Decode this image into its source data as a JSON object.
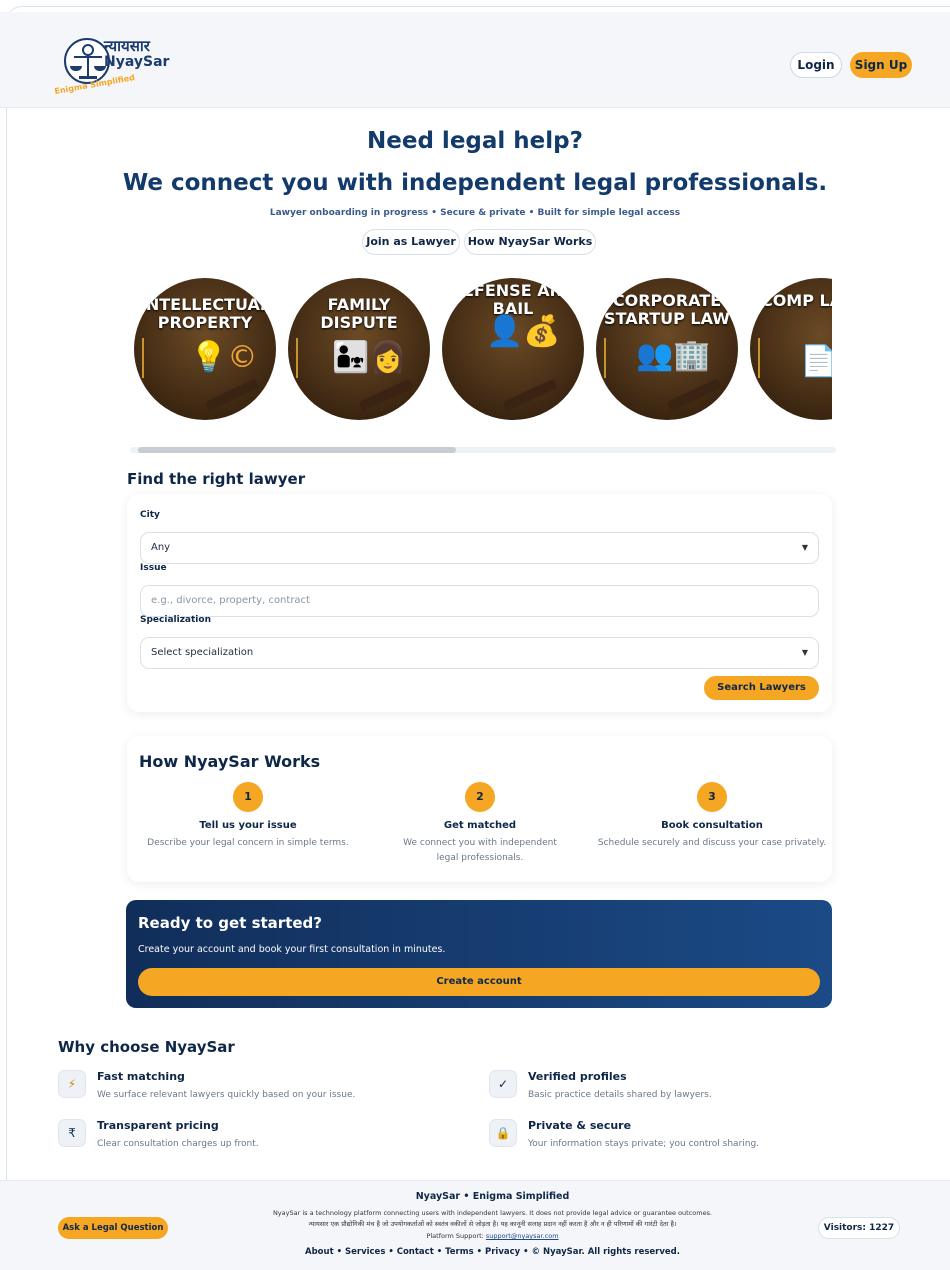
{
  "header": {
    "logo_hindi": "न्यायसार",
    "logo_name": "NyaySar",
    "logo_tagline": "Enigma Simplified",
    "login_label": "Login",
    "signup_label": "Sign Up"
  },
  "hero": {
    "line1": "Need legal help?",
    "line2": "We connect you with independent legal professionals.",
    "subline": "Lawyer onboarding in progress • Secure & private • Built for simple legal access",
    "join_label": "Join as Lawyer",
    "how_label": "How NyaySar Works"
  },
  "categories": [
    {
      "title": "INTELLECTUAL PROPERTY",
      "icon": "lightbulb-copyright-icon"
    },
    {
      "title": "FAMILY DISPUTE",
      "icon": "family-icon"
    },
    {
      "title": "DEFENSE AND BAIL",
      "icon": "money-bag-icon"
    },
    {
      "title": "CORPORATE STARTUP LAW",
      "icon": "business-icon"
    },
    {
      "title": "COMP LAW",
      "icon": "document-icon"
    }
  ],
  "find": {
    "title": "Find the right lawyer",
    "city_label": "City",
    "city_value": "Any",
    "issue_label": "Issue",
    "issue_placeholder": "e.g., divorce, property, contract",
    "spec_label": "Specialization",
    "spec_value": "Select specialization",
    "search_label": "Search Lawyers"
  },
  "how": {
    "title": "How NyaySar Works",
    "steps": [
      {
        "num": "1",
        "title": "Tell us your issue",
        "desc": "Describe your legal concern in simple terms."
      },
      {
        "num": "2",
        "title": "Get matched",
        "desc": "We connect you with independent legal professionals."
      },
      {
        "num": "3",
        "title": "Book consultation",
        "desc": "Schedule securely and discuss your case privately."
      }
    ]
  },
  "ready": {
    "title": "Ready to get started?",
    "subtitle": "Create your account and book your first consultation in minutes.",
    "button": "Create account"
  },
  "why": {
    "title": "Why choose NyaySar",
    "items": [
      {
        "icon": "lightning-icon",
        "title": "Fast matching",
        "desc": "We surface relevant lawyers quickly based on your issue."
      },
      {
        "icon": "check-icon",
        "title": "Verified profiles",
        "desc": "Basic practice details shared by lawyers."
      },
      {
        "icon": "rupee-icon",
        "title": "Transparent pricing",
        "desc": "Clear consultation charges up front."
      },
      {
        "icon": "lock-icon",
        "title": "Private & secure",
        "desc": "Your information stays private; you control sharing."
      }
    ]
  },
  "footer": {
    "ask_label": "Ask a Legal Question",
    "brand": "NyaySar • Enigma Simplified",
    "disclaimer_en": "NyaySar is a technology platform connecting users with independent lawyers. It does not provide legal advice or guarantee outcomes.",
    "disclaimer_hi": "न्यायसार एक प्रौद्योगिकी मंच है जो उपयोगकर्ताओं को स्वतंत्र वकीलों से जोड़ता है। यह कानूनी सलाह प्रदान नहीं करता है और न ही परिणामों की गारंटी देता है।",
    "support_label": "Platform Support:",
    "support_email": "support@nyaysar.com",
    "links": "About • Services • Contact • Terms • Privacy • © NyaySar. All rights reserved.",
    "visitors": "Visitors: 1227"
  },
  "colors": {
    "navy": "#0f2747",
    "accent": "#f5a623",
    "banner_start": "#112e5a",
    "banner_end": "#1b4a86"
  }
}
